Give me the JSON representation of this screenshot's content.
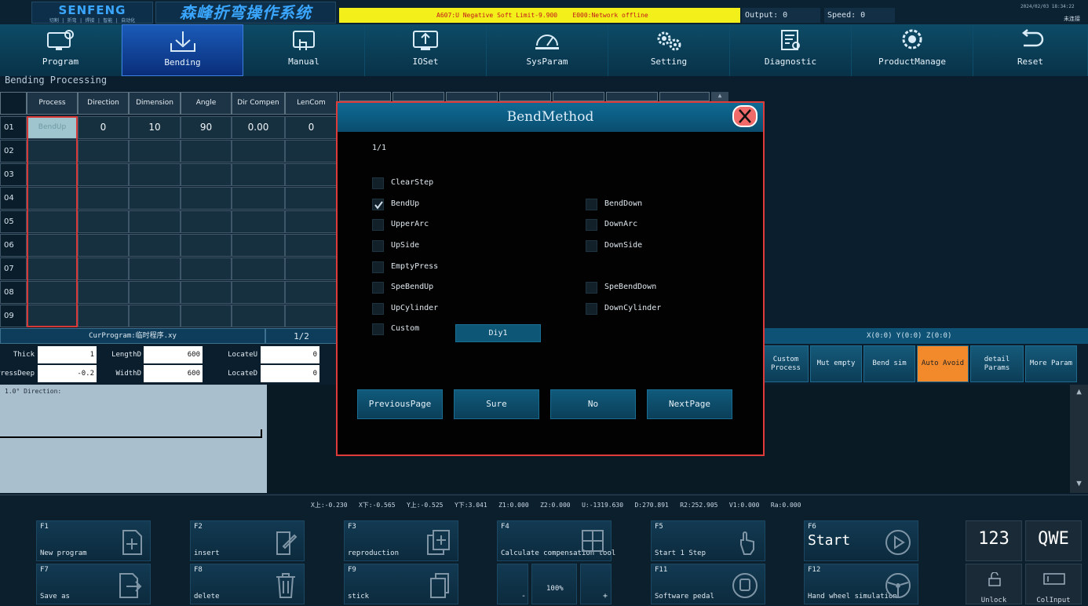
{
  "header": {
    "brand": "SENFENG",
    "brand_sub": "切割 | 折弯 | 焊接 | 智能 | 自动化",
    "system_title": "森峰折弯操作系统",
    "alarm": "A607:U Negative Soft Limit-9.900    E000:Network offline",
    "output": "Output: 0",
    "speed": "Speed: 0",
    "datetime": "2024/02/03 18:34:22",
    "connection": "未连接"
  },
  "nav": [
    {
      "label": "Program",
      "icon": "program-icon",
      "active": false
    },
    {
      "label": "Bending",
      "icon": "bending-icon",
      "active": true
    },
    {
      "label": "Manual",
      "icon": "manual-icon",
      "active": false
    },
    {
      "label": "IOSet",
      "icon": "ioset-icon",
      "active": false
    },
    {
      "label": "SysParam",
      "icon": "sysparam-icon",
      "active": false
    },
    {
      "label": "Setting",
      "icon": "gears-icon",
      "active": false
    },
    {
      "label": "Diagnostic",
      "icon": "diagnostic-icon",
      "active": false
    },
    {
      "label": "ProductManage",
      "icon": "product-manage-icon",
      "active": false
    },
    {
      "label": "Reset",
      "icon": "reset-icon",
      "active": false
    }
  ],
  "bending": {
    "title": "Bending Processing",
    "columns": [
      "Process",
      "Direction",
      "Dimension",
      "Angle",
      "Dir Compen",
      "LenCom"
    ],
    "rows": [
      {
        "no": "01",
        "cells": [
          "BendUp",
          "0",
          "10",
          "90",
          "0.00",
          "0"
        ]
      },
      {
        "no": "02",
        "cells": [
          "",
          "",
          "",
          "",
          "",
          ""
        ]
      },
      {
        "no": "03",
        "cells": [
          "",
          "",
          "",
          "",
          "",
          ""
        ]
      },
      {
        "no": "04",
        "cells": [
          "",
          "",
          "",
          "",
          "",
          ""
        ]
      },
      {
        "no": "05",
        "cells": [
          "",
          "",
          "",
          "",
          "",
          ""
        ]
      },
      {
        "no": "06",
        "cells": [
          "",
          "",
          "",
          "",
          "",
          ""
        ]
      },
      {
        "no": "07",
        "cells": [
          "",
          "",
          "",
          "",
          "",
          ""
        ]
      },
      {
        "no": "08",
        "cells": [
          "",
          "",
          "",
          "",
          "",
          ""
        ]
      },
      {
        "no": "09",
        "cells": [
          "",
          "",
          "",
          "",
          "",
          ""
        ]
      }
    ],
    "cur_program": "CurProgram:临时程序.xy",
    "page": "1/2",
    "params": {
      "thick_label": "Thick",
      "thick_value": "1",
      "lengthd_label": "LengthD",
      "lengthd_value": "600",
      "locateu_label": "LocateU",
      "locateu_value": "0",
      "pressdeep_label": "PressDeep",
      "pressdeep_value": "-0.2",
      "widthd_label": "WidthD",
      "widthd_value": "600",
      "located_label": "LocateD",
      "located_value": "0"
    },
    "graphic_label": "1.0° Direction:"
  },
  "right_panel": {
    "xyz": "X(0:0) Y(0:0) Z(0:0)",
    "buttons": [
      {
        "label": "Custom Process",
        "style": "normal"
      },
      {
        "label": "Mut empty",
        "style": "normal"
      },
      {
        "label": "Bend sim",
        "style": "normal"
      },
      {
        "label": "Auto Avoid",
        "style": "orange"
      },
      {
        "label": "detail Params",
        "style": "normal"
      },
      {
        "label": "More Param",
        "style": "normal"
      }
    ]
  },
  "coords": "X上:-0.230   X下:-0.565   Y上:-0.525   Y下:3.041   Z1:0.000   Z2:0.000   U:-1319.630   D:270.891   R2:252.905   V1:0.000   Ra:0.000",
  "fkeys": [
    {
      "key": "F1",
      "label": "New program",
      "icon": "plus-box-icon"
    },
    {
      "key": "F2",
      "label": "insert",
      "icon": "edit-icon"
    },
    {
      "key": "F3",
      "label": "reproduction",
      "icon": "copy-plus-icon"
    },
    {
      "key": "F4",
      "label": "Calculate compensation tool",
      "icon": "calculator-icon"
    },
    {
      "key": "F5",
      "label": "Start 1 Step",
      "icon": "hand-touch-icon"
    },
    {
      "key": "F6",
      "label": "Start",
      "icon": "play-circle-icon"
    },
    {
      "key": "F7",
      "label": "Save as",
      "icon": "save-as-icon"
    },
    {
      "key": "F8",
      "label": "delete",
      "icon": "trash-icon"
    },
    {
      "key": "F9",
      "label": "stick",
      "icon": "paste-icon"
    },
    {
      "key": "F11",
      "label": "Software pedal",
      "icon": "pedal-icon"
    },
    {
      "key": "F12",
      "label": "Hand wheel simulation",
      "icon": "handwheel-icon"
    }
  ],
  "zoom": {
    "minus": "-",
    "value": "100%",
    "plus": "+"
  },
  "keyboards": {
    "numeric": "123",
    "alpha": "QWE",
    "unlock": "Unlock",
    "colinput": "ColInput"
  },
  "dialog": {
    "title": "BendMethod",
    "page": "1/1",
    "options": [
      {
        "label": "ClearStep",
        "checked": false
      },
      {
        "label": "BendUp",
        "checked": true
      },
      {
        "label": "BendDown",
        "checked": false
      },
      {
        "label": "UpperArc",
        "checked": false
      },
      {
        "label": "DownArc",
        "checked": false
      },
      {
        "label": "UpSide",
        "checked": false
      },
      {
        "label": "DownSide",
        "checked": false
      },
      {
        "label": "EmptyPress",
        "checked": false
      },
      {
        "label": "SpeBendUp",
        "checked": false
      },
      {
        "label": "SpeBendDown",
        "checked": false
      },
      {
        "label": "UpCylinder",
        "checked": false
      },
      {
        "label": "DownCylinder",
        "checked": false
      },
      {
        "label": "Custom",
        "checked": false
      }
    ],
    "diy_label": "Diy1",
    "buttons": {
      "prev": "PreviousPage",
      "sure": "Sure",
      "no": "No",
      "next": "NextPage"
    }
  },
  "colors": {
    "accent": "#1a5bb8",
    "alarm_bg": "#f2ef1a",
    "alarm_text": "#c2161c",
    "dialog_border": "#e03b3b",
    "auto_avoid": "#f28a2c"
  }
}
